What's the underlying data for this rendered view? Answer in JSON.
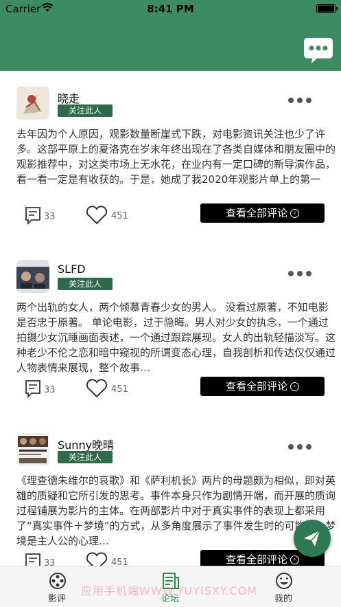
{
  "status_bar": {
    "carrier": "Carrier",
    "time": "8:41 PM"
  },
  "header": {
    "chat_icon": "chat-bubble-icon",
    "color": "#3d8b62"
  },
  "posts": [
    {
      "username": "晓走",
      "follow_label": "关注此人",
      "text": "去年因为个人原因，观影数量断崖式下跌，对电影资讯关注也少了许多。这部平原上的夏洛克在岁末年终出现在了各类自媒体和朋友圈中的观影推荐中，对这类市场上无水花，在业内有一定口碑的新导演作品，看一看一定是有收获的。于是，她成了我2020年观影片单上的第一部。看完电影，我几乎可以明…",
      "comment_count": "33",
      "like_count": "451",
      "view_all_label": "查看全部评论"
    },
    {
      "username": "SLFD",
      "follow_label": "关注此人",
      "text": "两个出轨的女人，两个倾慕青春少女的男人。 没看过原著，不知电影是否忠于原著。 单论电影，过于隐晦。男人对少女的执念，一个通过拍摄少女沉睡画面表述，一个通过跟踪展现。女人的出轨轻描淡写。这种老少不伦之恋和暗中窥视的所谓变态心理，自我剖析和传达仅仅通过人物表情来展现，整个故事…",
      "comment_count": "33",
      "like_count": "451",
      "view_all_label": "查看全部评论"
    },
    {
      "username": "Sunny晚晴",
      "follow_label": "关注此人",
      "text": "《理查德朱维尔的哀歌》和《萨利机长》两片的母题颇为相似，即对英雄的质疑和它所引发的思考。事件本身只作为剧情开端，而开展的质询过程铺展为影片的主体。在两部影片中对于真实事件的表现上都采用了“真实事件＋梦境”的方式，从多角度展示了事件发生时的可能性，梦境是主人公的心理…",
      "comment_count": "33",
      "like_count": "451",
      "view_all_label": "查看全部评论"
    }
  ],
  "tabs": [
    {
      "label": "影评",
      "icon": "film-reel-icon",
      "active": false
    },
    {
      "label": "论坛",
      "icon": "forum-document-icon",
      "active": true
    },
    {
      "label": "我的",
      "icon": "smiley-face-icon",
      "active": false
    }
  ],
  "watermark": "应用手机端WWW.YUYISXY.COM",
  "colors": {
    "primary": "#3d8b62",
    "follow": "#2e6b4c",
    "active_tab": "#2d8a4e",
    "fab": "#2f7a55"
  }
}
